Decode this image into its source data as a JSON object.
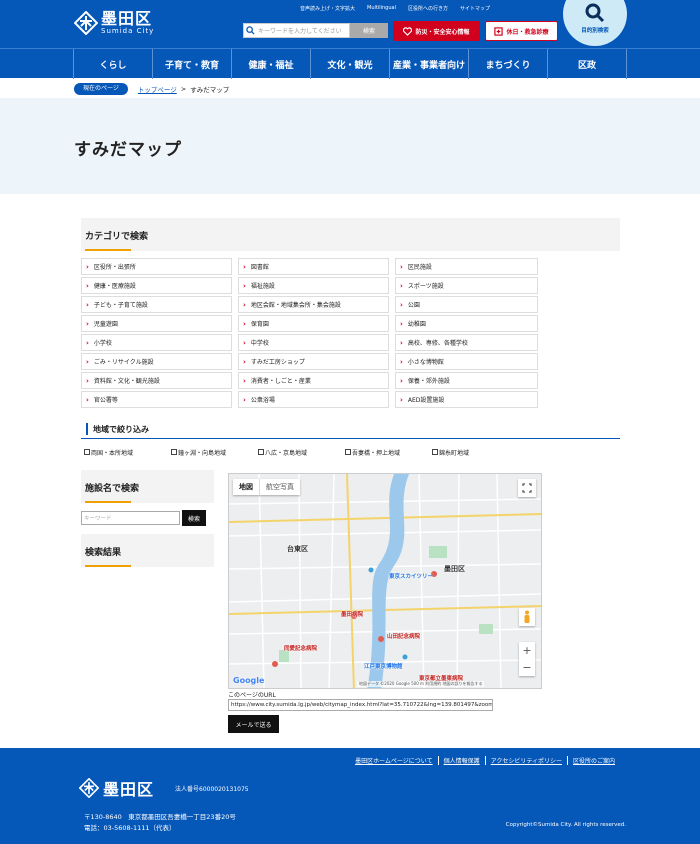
{
  "header": {
    "logo_jp": "墨田区",
    "logo_en": "Sumida City",
    "util_links": [
      "音声読み上げ・文字拡大",
      "Multilingual",
      "区役所への行き方",
      "サイトマップ"
    ],
    "search_placeholder": "キーワードを入力してください",
    "search_button": "検索",
    "disaster_button": "防災・安全安心情報",
    "holiday_button": "休日・救急診療",
    "purpose_search": "目的別検索"
  },
  "nav": [
    "くらし",
    "子育て・教育",
    "健康・福祉",
    "文化・観光",
    "産業・事業者向け",
    "まちづくり",
    "区政"
  ],
  "breadcrumb": {
    "current_badge": "現在のページ",
    "top_link": "トップページ",
    "separator": ">",
    "current": "すみだマップ"
  },
  "page_title": "すみだマップ",
  "category": {
    "heading": "カテゴリで検索",
    "items": [
      "区役所・出張所",
      "図書館",
      "区民施設",
      "健康・医療施設",
      "福祉施設",
      "スポーツ施設",
      "子ども・子育て施設",
      "地区会館・地域集会所・集会施設",
      "公園",
      "児童遊園",
      "保育園",
      "幼稚園",
      "小学校",
      "中学校",
      "高校、専修、各種学校",
      "ごみ・リサイクル施設",
      "すみだ工房ショップ",
      "小さな博物館",
      "資料館・文化・観光施設",
      "消費者・しごと・産業",
      "保養・郊外施設",
      "官公署等",
      "公衆浴場",
      "AED設置施設"
    ]
  },
  "area": {
    "heading": "地域で絞り込み",
    "items": [
      "両国・本所地域",
      "鐘ヶ淵・向島地域",
      "八広・京島地域",
      "吾妻橋・押上地域",
      "錦糸町地域"
    ]
  },
  "facility": {
    "heading": "施設名で検索",
    "placeholder": "キーワード",
    "button": "検索"
  },
  "results": {
    "heading": "検索結果"
  },
  "map": {
    "tab_map": "地図",
    "tab_aerial": "航空写真",
    "labels": [
      "台東区",
      "墨田区",
      "東京スカイツリー",
      "墨田病院",
      "山田記念病院",
      "同愛記念病院",
      "江戸東京博物館",
      "東京都立墨東病院"
    ],
    "footer": "地図データ ©2020 Google   500 m   利用規約   地図の誤りを報告する",
    "google": "Google"
  },
  "page_url_label": "このページのURL",
  "page_url": "https://www.city.sumida.lg.jp/web/citymap_index.html?lat=35.710722&lng=139.801497&zoom",
  "mail_button": "メールで送る",
  "footer": {
    "links": [
      "墨田区ホームページについて",
      "個人情報保護",
      "アクセシビリティポリシー",
      "区役所のご案内"
    ],
    "logo_jp": "墨田区",
    "corp_no": "法人番号6000020131075",
    "address": "〒130-8640　東京都墨田区吾妻橋一丁目23番20号",
    "phone": "電話：03-5608-1111（代表）",
    "copyright": "Copyright©Sumida City. All rights reserved."
  },
  "colors": {
    "brand_blue": "#0557b8",
    "alert_red": "#d1001c",
    "accent_orange": "#f0a000"
  }
}
